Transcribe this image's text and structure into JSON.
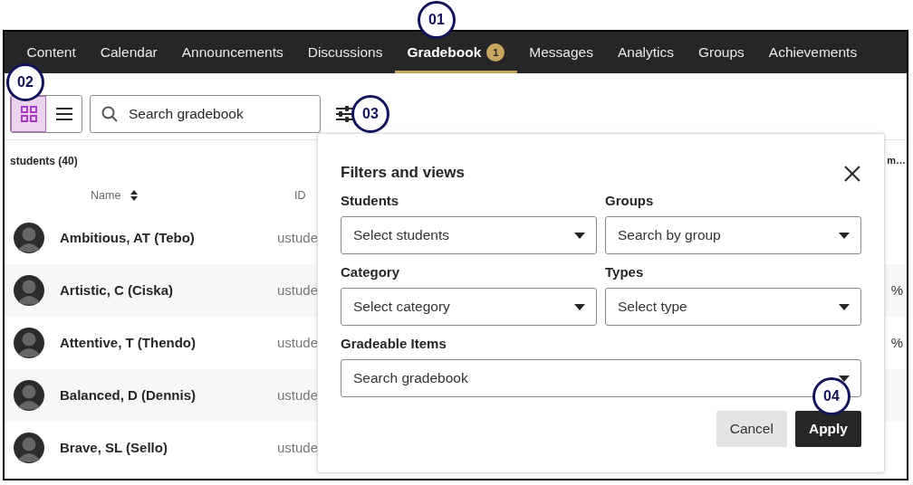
{
  "nav": {
    "tabs": [
      {
        "label": "Content",
        "selected": false
      },
      {
        "label": "Calendar",
        "selected": false
      },
      {
        "label": "Announcements",
        "selected": false
      },
      {
        "label": "Discussions",
        "selected": false
      },
      {
        "label": "Gradebook",
        "selected": true,
        "badge": "1"
      },
      {
        "label": "Messages",
        "selected": false
      },
      {
        "label": "Analytics",
        "selected": false
      },
      {
        "label": "Groups",
        "selected": false
      },
      {
        "label": "Achievements",
        "selected": false
      }
    ]
  },
  "toolbar": {
    "views": [
      {
        "kind": "grid",
        "selected": true
      },
      {
        "kind": "list",
        "selected": false
      }
    ],
    "search": {
      "placeholder": "Search gradebook"
    }
  },
  "table": {
    "caption": "students (40)",
    "columns": [
      "Name",
      "ID"
    ],
    "column_3": "m…",
    "rows": [
      {
        "name": "Ambitious, AT (Tebo)",
        "id": "ustude"
      },
      {
        "name": "Artistic, C (Ciska)",
        "id": "ustude",
        "column_3": "%"
      },
      {
        "name": "Attentive, T (Thendo)",
        "id": "ustude",
        "column_3": "%"
      },
      {
        "name": "Balanced, D (Dennis)",
        "id": "ustude"
      },
      {
        "name": "Brave, SL (Sello)",
        "id": "ustude"
      }
    ]
  },
  "panel": {
    "title": "Filters and views",
    "fields": [
      {
        "label": "Students",
        "placeholder": "Select students"
      },
      {
        "label": "Groups",
        "placeholder": "Search by group"
      },
      {
        "label": "Category",
        "placeholder": "Select category"
      },
      {
        "label": "Types",
        "placeholder": "Select type"
      },
      {
        "label": "Gradeable Items",
        "placeholder": "Search gradebook",
        "wide": true
      }
    ],
    "buttons": [
      {
        "label": "Cancel",
        "kind": "secondary"
      },
      {
        "label": "Apply",
        "kind": "primary"
      }
    ]
  },
  "callouts": [
    "01",
    "02",
    "03",
    "04"
  ]
}
